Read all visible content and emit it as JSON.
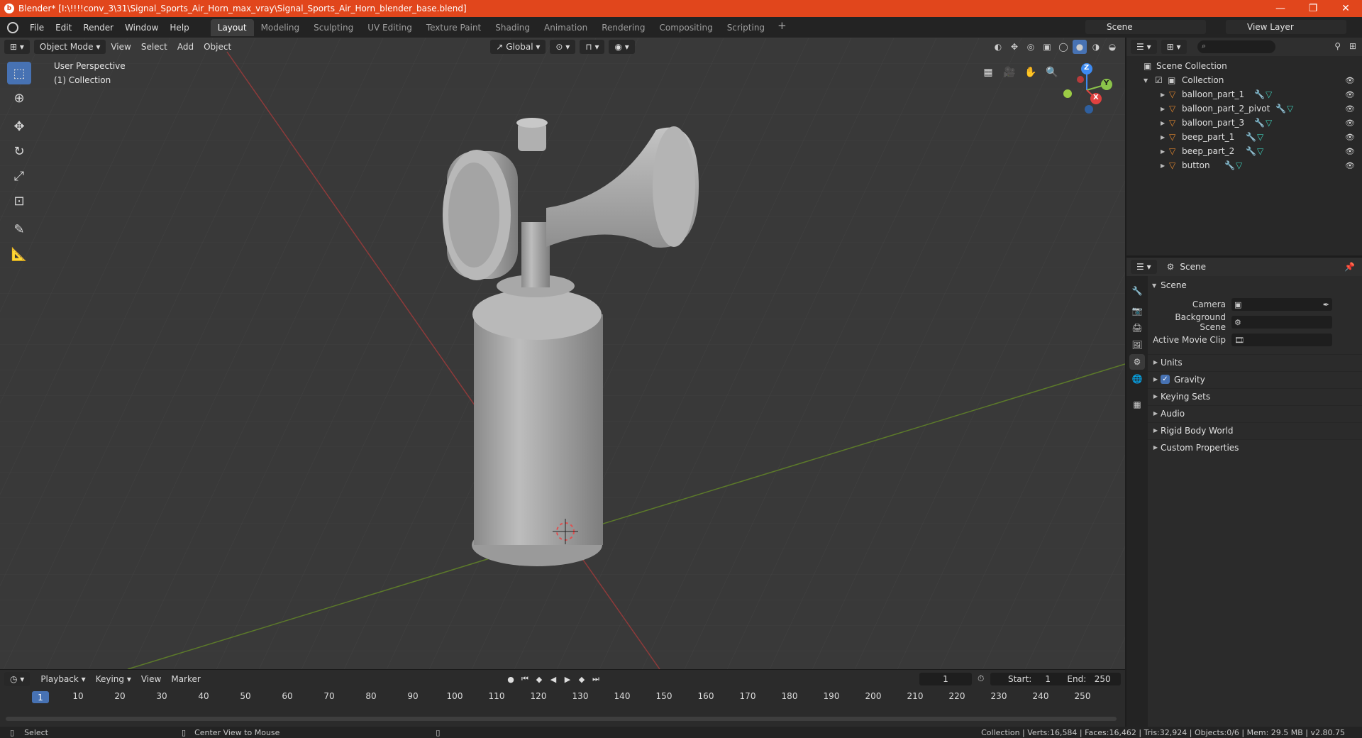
{
  "window": {
    "title": "Blender* [I:\\!!!!conv_3\\31\\Signal_Sports_Air_Horn_max_vray\\Signal_Sports_Air_Horn_blender_base.blend]",
    "minimize": "—",
    "maximize": "❐",
    "close": "✕"
  },
  "menubar": {
    "items": [
      "File",
      "Edit",
      "Render",
      "Window",
      "Help"
    ],
    "workspaces": [
      "Layout",
      "Modeling",
      "Sculpting",
      "UV Editing",
      "Texture Paint",
      "Shading",
      "Animation",
      "Rendering",
      "Compositing",
      "Scripting"
    ],
    "active_workspace": "Layout",
    "add_tab": "+",
    "scene": "Scene",
    "view_layer": "View Layer"
  },
  "viewport": {
    "mode": "Object Mode",
    "menus": [
      "View",
      "Select",
      "Add",
      "Object"
    ],
    "orientation": "Global",
    "view_label": "User Perspective",
    "collection_label": "(1) Collection",
    "gizmo": {
      "x": "X",
      "y": "Y",
      "z": "Z"
    }
  },
  "timeline": {
    "menus": [
      "Playback",
      "Keying",
      "View",
      "Marker"
    ],
    "current_frame": "1",
    "start_label": "Start:",
    "start": "1",
    "end_label": "End:",
    "end": "250",
    "ticks": [
      "10",
      "20",
      "30",
      "40",
      "50",
      "60",
      "70",
      "80",
      "90",
      "100",
      "110",
      "120",
      "130",
      "140",
      "150",
      "160",
      "170",
      "180",
      "190",
      "200",
      "210",
      "220",
      "230",
      "240",
      "250"
    ],
    "frame_indicator": "1"
  },
  "statusbar": {
    "select": "Select",
    "center_view": "Center View to Mouse",
    "stats": "Collection | Verts:16,584 | Faces:16,462 | Tris:32,924 | Objects:0/6 | Mem: 29.5 MB | v2.80.75"
  },
  "outliner": {
    "root": "Scene Collection",
    "collection": "Collection",
    "objects": [
      "balloon_part_1",
      "balloon_part_2_pivot",
      "balloon_part_3",
      "beep_part_1",
      "beep_part_2",
      "button"
    ]
  },
  "properties": {
    "context": "Scene",
    "panel": "Scene",
    "camera_label": "Camera",
    "background_scene_label": "Background Scene",
    "active_movie_clip_label": "Active Movie Clip",
    "subpanels": [
      "Units",
      "Gravity",
      "Keying Sets",
      "Audio",
      "Rigid Body World",
      "Custom Properties"
    ]
  },
  "colors": {
    "titlebar": "#e1461c",
    "accent": "#4772b3",
    "x_axis": "#e0413f",
    "y_axis": "#8bc34a",
    "z_axis": "#3d8bf2"
  }
}
